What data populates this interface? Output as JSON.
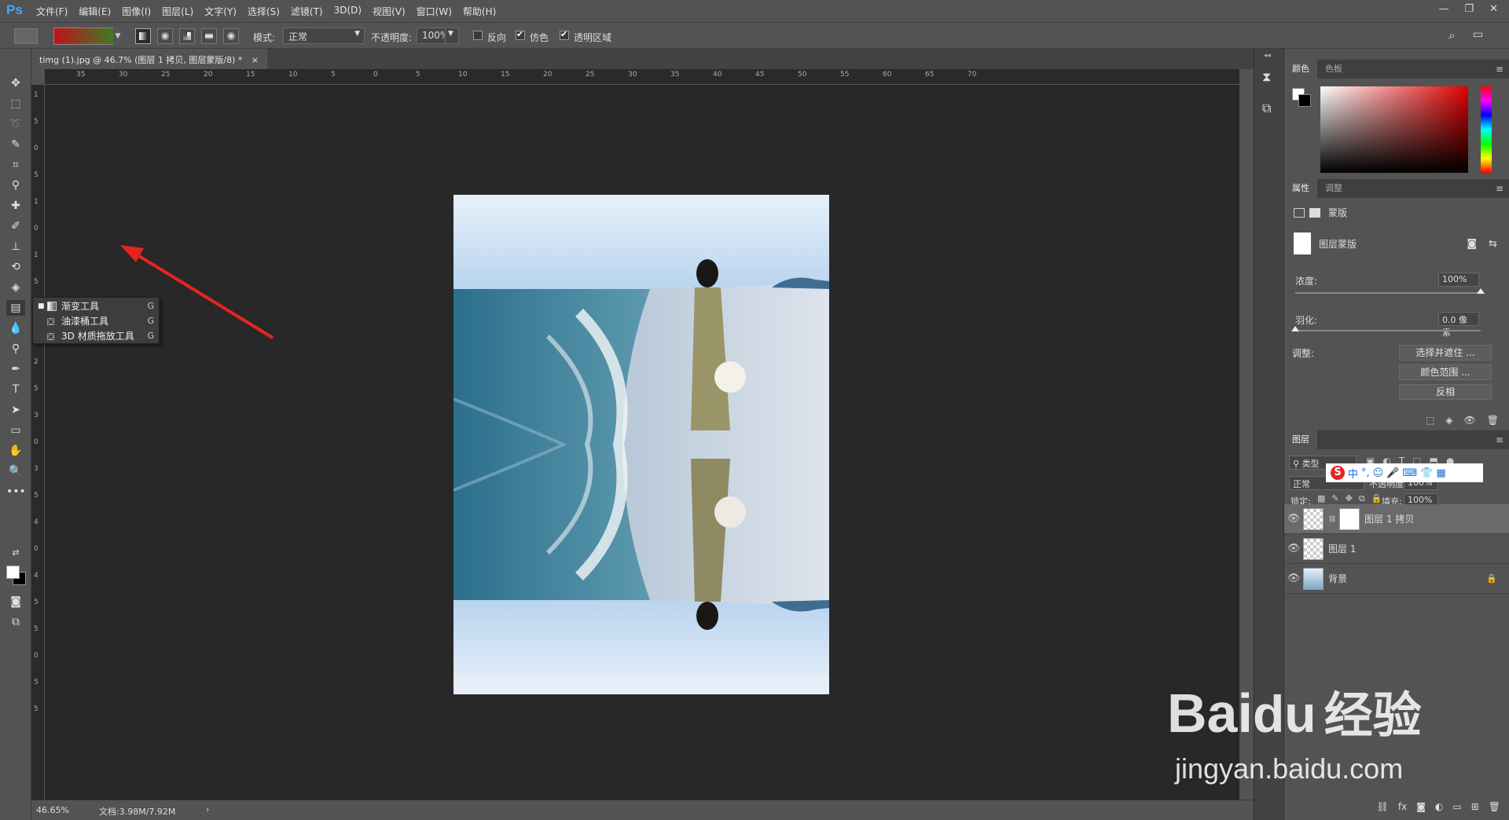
{
  "app": {
    "logo": "Ps"
  },
  "menu": [
    "文件(F)",
    "编辑(E)",
    "图像(I)",
    "图层(L)",
    "文字(Y)",
    "选择(S)",
    "滤镜(T)",
    "3D(D)",
    "视图(V)",
    "窗口(W)",
    "帮助(H)"
  ],
  "window_controls": [
    "—",
    "❐",
    "✕"
  ],
  "options": {
    "mode_label": "模式:",
    "mode_value": "正常",
    "opacity_label": "不透明度:",
    "opacity_value": "100%",
    "reverse_label": "反向",
    "dither_label": "仿色",
    "transparency_label": "透明区域",
    "reverse_checked": false,
    "dither_checked": true,
    "transparency_checked": true,
    "gradient_colors": [
      "#c0121a",
      "#2c8a28"
    ]
  },
  "doc_tab": {
    "title": "timg (1).jpg @ 46.7% (图层 1 拷贝, 图层蒙版/8) *",
    "close": "×"
  },
  "ruler_h": [
    "35",
    "30",
    "25",
    "20",
    "15",
    "10",
    "5",
    "0",
    "5",
    "10",
    "15",
    "20",
    "25",
    "30",
    "35",
    "40",
    "45",
    "50",
    "55",
    "60",
    "65",
    "70"
  ],
  "ruler_v": [
    "1",
    "5",
    "0",
    "5",
    "1",
    "0",
    "1",
    "5",
    "2",
    "0",
    "2",
    "5",
    "3",
    "0",
    "3",
    "5",
    "4",
    "0",
    "4",
    "5",
    "5",
    "0",
    "5",
    "5"
  ],
  "context_menu": [
    {
      "label": "渐变工具",
      "key": "G",
      "icon": "gradient-icon"
    },
    {
      "label": "油漆桶工具",
      "key": "G",
      "icon": "paint-bucket-icon"
    },
    {
      "label": "3D 材质拖放工具",
      "key": "G",
      "icon": "3d-material-drop-icon"
    }
  ],
  "status": {
    "zoom": "46.65%",
    "doc": "文档:3.98M/7.92M",
    "arrow": "›"
  },
  "panels": {
    "color_tabs": [
      "颜色",
      "色板"
    ],
    "props_tabs": [
      "属性",
      "调整"
    ],
    "mask_label": "蒙版",
    "layer_mask_label": "图层蒙版",
    "density_label": "浓度:",
    "density_value": "100%",
    "density_level": 1.0,
    "feather_label": "羽化:",
    "feather_value": "0.0 像素",
    "feather_level": 0.0,
    "adjust_label": "调整:",
    "btn_select_mask": "选择并遮住 ...",
    "btn_color_range": "颜色范围 ...",
    "btn_invert": "反相",
    "layers_tab": "图层",
    "filter_kind": "类型",
    "blend_mode": "正常",
    "opacity_label": "不透明度:",
    "opacity_value": "100%",
    "lock_label": "锁定:",
    "fill_label": "填充:",
    "fill_value": "100%",
    "layers": [
      {
        "name": "图层 1 拷贝",
        "selected": true
      },
      {
        "name": "图层 1",
        "selected": false
      },
      {
        "name": "背景",
        "selected": false
      }
    ]
  },
  "ime": {
    "brand": "S",
    "items": [
      "中",
      "°,",
      "☺",
      "🎤",
      "⌨",
      "👕",
      "👕",
      "▦"
    ]
  },
  "watermark": {
    "brand": "Bai",
    "brand2": "du",
    "cn": "经验",
    "url": "jingyan.baidu.com"
  }
}
